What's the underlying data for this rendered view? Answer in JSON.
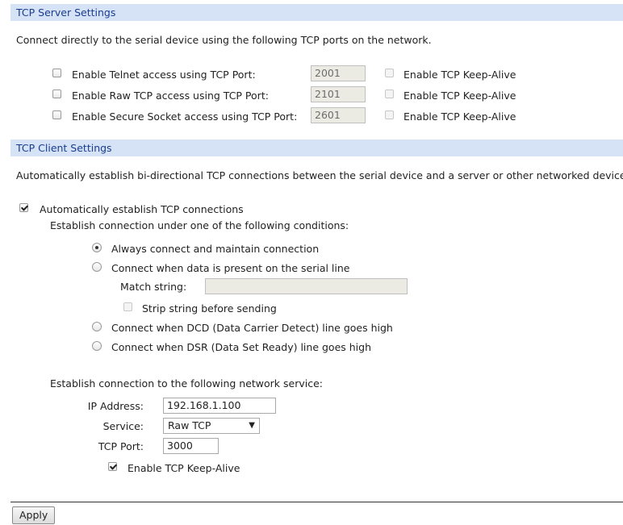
{
  "server": {
    "title": "TCP Server Settings",
    "description": "Connect directly to the serial device using the following TCP ports on the network.",
    "rows": [
      {
        "label": "Enable Telnet access using TCP Port:",
        "port": "2001",
        "keepalive_label": "Enable TCP Keep-Alive",
        "enabled": false
      },
      {
        "label": "Enable Raw TCP access using TCP Port:",
        "port": "2101",
        "keepalive_label": "Enable TCP Keep-Alive",
        "enabled": false
      },
      {
        "label": "Enable Secure Socket access using TCP Port:",
        "port": "2601",
        "keepalive_label": "Enable TCP Keep-Alive",
        "enabled": false
      }
    ]
  },
  "client": {
    "title": "TCP Client Settings",
    "description": "Automatically establish bi-directional TCP connections between the serial device and a server or other networked device.",
    "auto_connect_label": "Automatically establish TCP connections",
    "auto_connect_checked": true,
    "conditions_heading": "Establish connection under one of the following conditions:",
    "options": {
      "always": "Always connect and maintain connection",
      "data": "Connect when data is present on the serial line",
      "dcd": "Connect when DCD (Data Carrier Detect) line goes high",
      "dsr": "Connect when DSR (Data Set Ready) line goes high"
    },
    "selected_option": "always",
    "match_string_label": "Match string:",
    "match_string_value": "",
    "strip_label": "Strip string before sending",
    "service_heading": "Establish connection to the following network service:",
    "ip_label": "IP Address:",
    "ip_value": "192.168.1.100",
    "service_label": "Service:",
    "service_value": "Raw TCP",
    "port_label": "TCP Port:",
    "port_value": "3000",
    "keepalive_label": "Enable TCP Keep-Alive",
    "keepalive_checked": true
  },
  "apply_label": "Apply",
  "icons": {
    "dropdown": "dropdown-arrow-icon"
  }
}
